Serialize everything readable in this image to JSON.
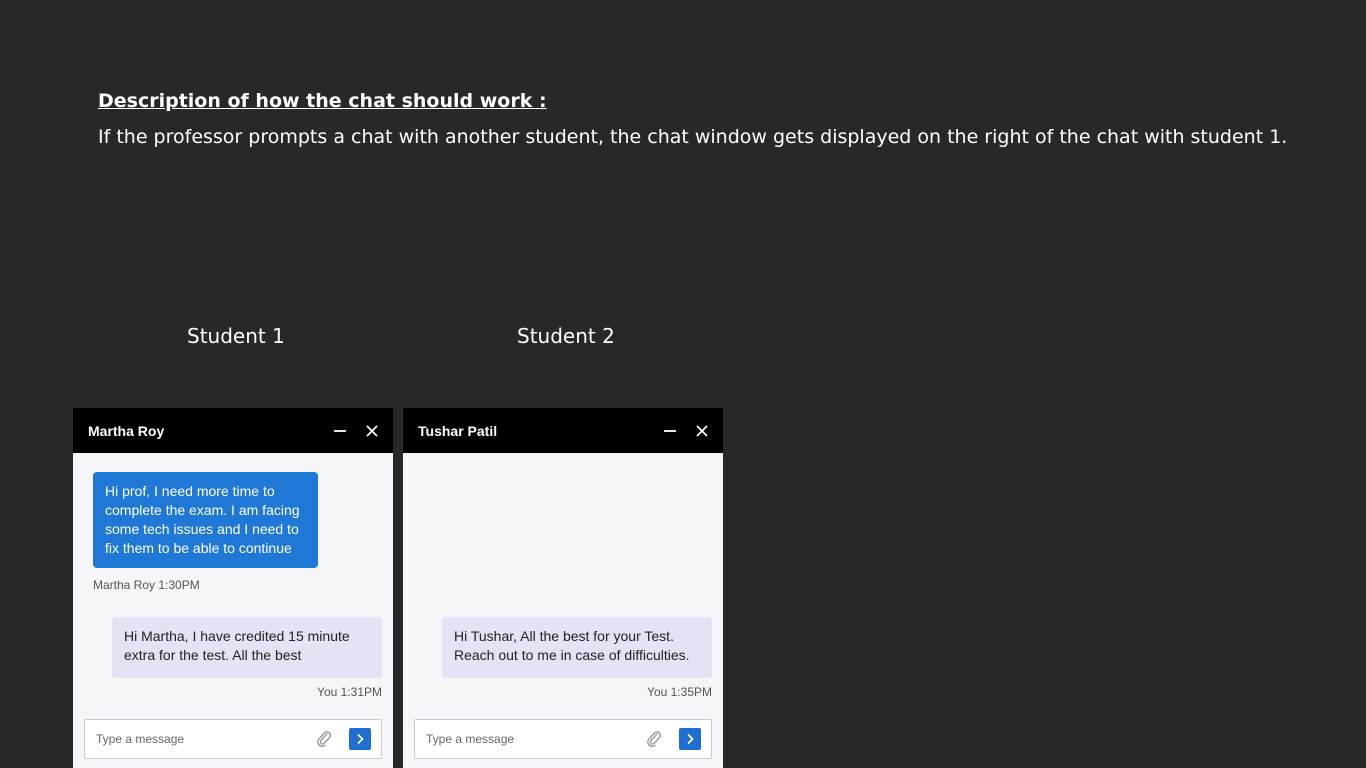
{
  "description": {
    "title": "Description of how the chat should work :",
    "body": "If the professor prompts a chat with another student, the chat window gets displayed on the right of the chat with student 1."
  },
  "labels": {
    "student1": "Student 1",
    "student2": "Student 2"
  },
  "chats": [
    {
      "name": "Martha Roy",
      "incoming": {
        "text": "Hi prof, I need more time to complete the exam. I am facing some tech issues and I need to fix them to be able to continue",
        "meta": "Martha Roy 1:30PM"
      },
      "outgoing": {
        "text": "Hi Martha, I have credited 15 minute extra for the test. All the best",
        "meta": "You 1:31PM"
      },
      "placeholder": "Type a message"
    },
    {
      "name": "Tushar Patil",
      "outgoing": {
        "text": "Hi Tushar, All the best for your Test. Reach out to me in case of difficulties.",
        "meta": "You 1:35PM"
      },
      "placeholder": "Type a message"
    }
  ],
  "colors": {
    "background": "#282828",
    "header": "#000000",
    "incoming_bubble": "#1f78d6",
    "outgoing_bubble": "#e3e3f5",
    "send_button": "#1f6fd1"
  },
  "icons": [
    "minimize-icon",
    "close-icon",
    "attach-icon",
    "send-icon"
  ]
}
